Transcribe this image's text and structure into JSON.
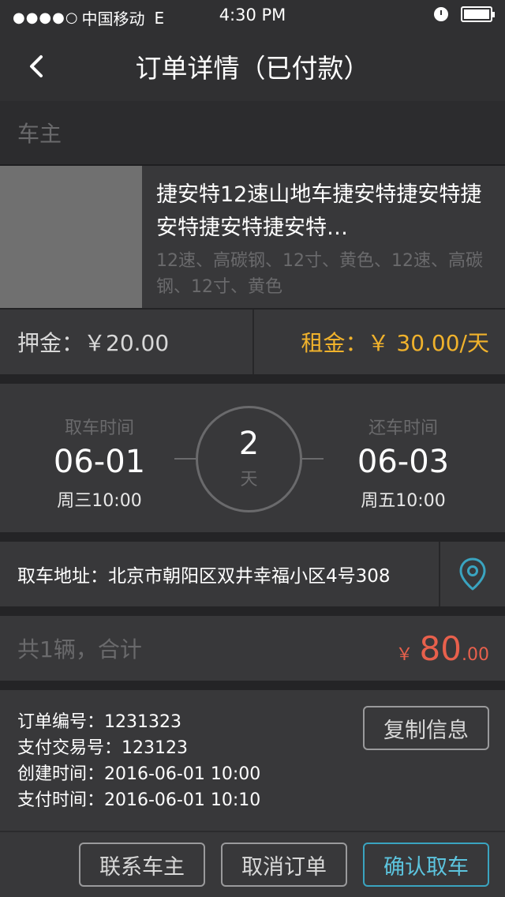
{
  "status_bar": {
    "signal": "●●●●○",
    "carrier": "中国移动",
    "network": "E",
    "time": "4:30 PM"
  },
  "nav": {
    "title": "订单详情（已付款）",
    "back_icon": "chevron-left-icon"
  },
  "owner": {
    "label": "车主"
  },
  "product": {
    "name": "捷安特12速山地车捷安特捷安特捷安特捷安特捷安特…",
    "specs": "12速、高碳钢、12寸、黄色、12速、高碳钢、12寸、黄色"
  },
  "prices": {
    "deposit": "押金：￥20.00",
    "rent": "租金：￥ 30.00/天"
  },
  "rental": {
    "pickup_label": "取车时间",
    "pickup_date": "06-01",
    "pickup_time": "周三10:00",
    "days": "2",
    "days_unit": "天",
    "return_label": "还车时间",
    "return_date": "06-03",
    "return_time": "周五10:00"
  },
  "address": {
    "text": "取车地址：北京市朝阳区双井幸福小区4号308",
    "icon": "location-pin-icon"
  },
  "total": {
    "label": "共1辆，合计",
    "currency": "￥",
    "amount_int": "80",
    "amount_dec": ".00"
  },
  "order_info": {
    "order_no": "订单编号：1231323",
    "trade_no": "支付交易号：123123",
    "created": "创建时间：2016-06-01  10:00",
    "paid": "支付时间：2016-06-01  10:10",
    "copy_label": "复制信息"
  },
  "actions": {
    "contact_owner": "联系车主",
    "cancel_order": "取消订单",
    "confirm_pickup": "确认取车"
  },
  "colors": {
    "accent_blue": "#3aa4c0",
    "rent_yellow": "#f0b22c",
    "total_red": "#e8604c"
  }
}
